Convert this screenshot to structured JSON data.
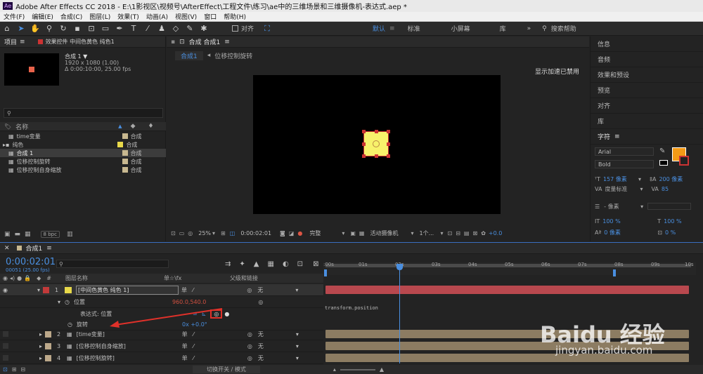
{
  "app": {
    "title": "Adobe After Effects CC 2018 - E:\\1影视区\\视频号\\AfterEffect\\工程文件\\练习\\ae中的三维场景和三维摄像机-表达式.aep *",
    "logo": "Ae"
  },
  "menu": [
    "文件(F)",
    "编辑(E)",
    "合成(C)",
    "图层(L)",
    "效果(T)",
    "动画(A)",
    "视图(V)",
    "窗口",
    "帮助(H)"
  ],
  "toolbar": {
    "align_label": "对齐",
    "workspaces": [
      "默认",
      "标准",
      "小屏幕",
      "库"
    ],
    "search_placeholder": "搜索帮助",
    "more": "»"
  },
  "project_panel": {
    "tab": "项目",
    "effects_tab": "效果控件 中间色黄色 纯色1",
    "comp_name": "合成 1 ▼",
    "comp_size": "1920 x 1080 (1.00)",
    "comp_duration": "Δ 0:00:10:00, 25.00 fps",
    "search_placeholder": "",
    "column_name": "名称",
    "items": [
      {
        "name": "time变量",
        "type": "合成",
        "color": "#c8b890",
        "selected": false
      },
      {
        "name": "纯色",
        "type": "合成",
        "color": "#e8d94a",
        "selected": false
      },
      {
        "name": "合成 1",
        "type": "合成",
        "color": "#c8b890",
        "selected": true
      },
      {
        "name": "位移控制旋转",
        "type": "合成",
        "color": "#c8b890",
        "selected": false
      },
      {
        "name": "位移控制自身缩放",
        "type": "合成",
        "color": "#c8b890",
        "selected": false
      }
    ],
    "bpc": "8 bpc"
  },
  "composition_panel": {
    "tab": "合成 合成1",
    "breadcrumbs": [
      "合成1",
      "位移控制旋转"
    ],
    "accel_text": "显示加速已禁用",
    "zoom": "25%",
    "timecode": "0:00:02:01",
    "quality": "完整",
    "camera": "活动摄像机",
    "views": "1个...",
    "exposure": "+0.0"
  },
  "right_panel": {
    "items": [
      "信息",
      "音频",
      "效果和预设",
      "预览",
      "对齐",
      "库"
    ],
    "character_tab": "字符",
    "font": "Arial",
    "style": "Bold",
    "size": "157 像素",
    "leading": "200 像素",
    "tracking_label": "度量标准",
    "tracking": "85",
    "indent": "- 像素",
    "scale_v": "100 %",
    "scale_h": "100 %",
    "baseline": "0 像素",
    "tsume": "0 %"
  },
  "timeline": {
    "tab": "合成1",
    "timecode": "0:00:02:01",
    "timecode_sub": "00051 (25.00 fps)",
    "search_placeholder": "",
    "col_layer_name": "图层名称",
    "col_switches": "单☆\\fx",
    "col_parent": "父级和链接",
    "ticks": [
      ":00s",
      "01s",
      "02s",
      "03s",
      "04s",
      "05s",
      "06s",
      "07s",
      "08s",
      "09s",
      "10s"
    ],
    "layers": [
      {
        "num": "1",
        "name": "[中间色黄色 纯色 1]",
        "parent": "无",
        "color": "#c23a3a",
        "label": "#e8d94a"
      },
      {
        "num": "2",
        "name": "[time变量]",
        "parent": "无",
        "color": "#bca88a",
        "label": "#c8b890"
      },
      {
        "num": "3",
        "name": "[位移控制自身缩放]",
        "parent": "无",
        "color": "#bca88a",
        "label": "#c8b890"
      },
      {
        "num": "4",
        "name": "[位移控制旋转]",
        "parent": "无",
        "color": "#bca88a",
        "label": "#c8b890"
      }
    ],
    "position_label": "位置",
    "position_value": "960.0,540.0",
    "expression_label": "表达式: 位置",
    "expression_text": "transform.position",
    "rotation_label": "旋转",
    "rotation_value": "0x +0.0°",
    "footer_toggle": "切换开关 / 模式"
  },
  "watermark": {
    "brand": "Baidu 经验",
    "url": "jingyan.baidu.com"
  }
}
